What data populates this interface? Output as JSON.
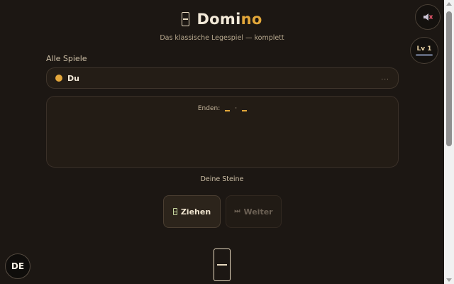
{
  "header": {
    "title_part1": "Domi",
    "title_part2": "no",
    "subtitle": "Das klassische Legespiel — komplett"
  },
  "controls": {
    "sound_icon": "muted-speaker-icon",
    "level_label": "Lv 1",
    "language_label": "DE"
  },
  "players": {
    "section_label": "Alle Spiele",
    "current": {
      "name": "Du",
      "more": "...",
      "color": "#e4a73b"
    }
  },
  "board": {
    "ends_label": "Enden:",
    "ends_separator": "·"
  },
  "hand": {
    "label": "Deine Steine"
  },
  "actions": {
    "draw_label": "Ziehen",
    "next_label": "Weiter"
  },
  "colors": {
    "background": "#1c1713",
    "accent": "#e2a73a"
  }
}
